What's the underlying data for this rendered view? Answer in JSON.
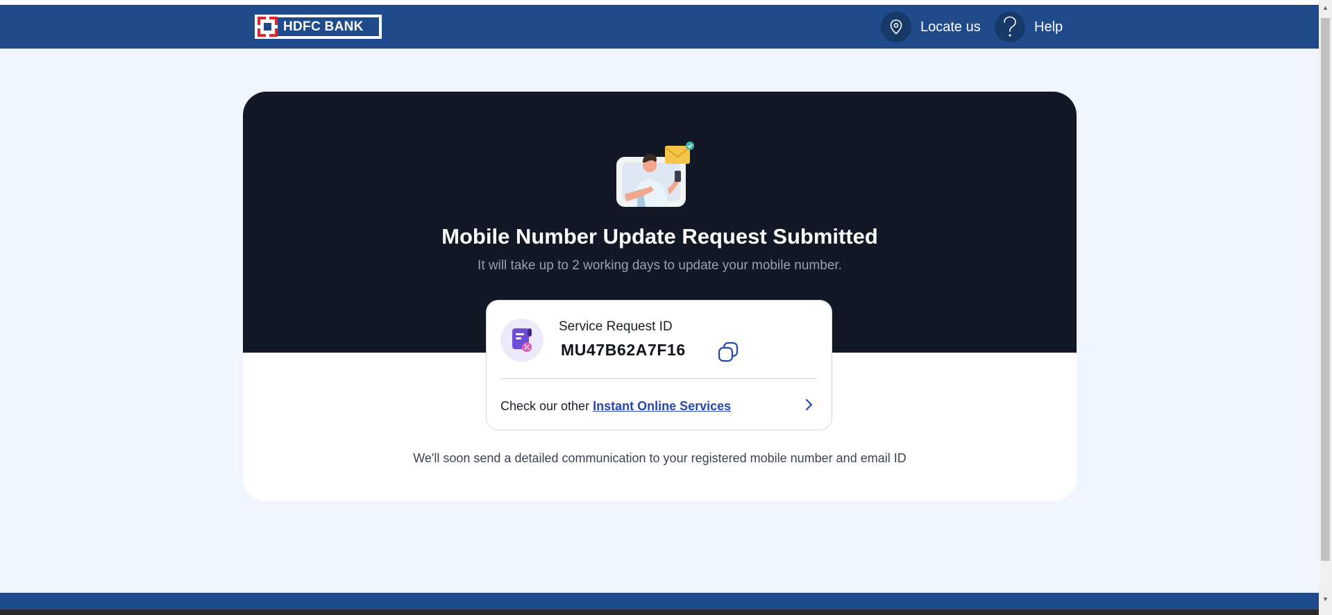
{
  "header": {
    "logo_text": "HDFC BANK",
    "locate_label": "Locate us",
    "help_label": "Help"
  },
  "hero": {
    "title": "Mobile Number Update Request Submitted",
    "subtitle": "It will take up to 2 working days to update your mobile number."
  },
  "request": {
    "label": "Service Request ID",
    "id": "MU47B62A7F16",
    "other_prefix": "Check our other",
    "other_link": "Instant Online Services"
  },
  "note": "We'll soon send a detailed communication to your registered mobile number and email ID",
  "colors": {
    "header_bg": "#1f4b8d",
    "page_bg": "#f1f5fd",
    "hero_bg": "#121826",
    "link": "#2446b8",
    "logo_red": "#e1242a"
  },
  "icons": {
    "locate": "location-pin-icon",
    "help": "question-mark-icon",
    "copy": "copy-icon",
    "chevron": "chevron-right-icon",
    "request": "document-percent-icon"
  }
}
